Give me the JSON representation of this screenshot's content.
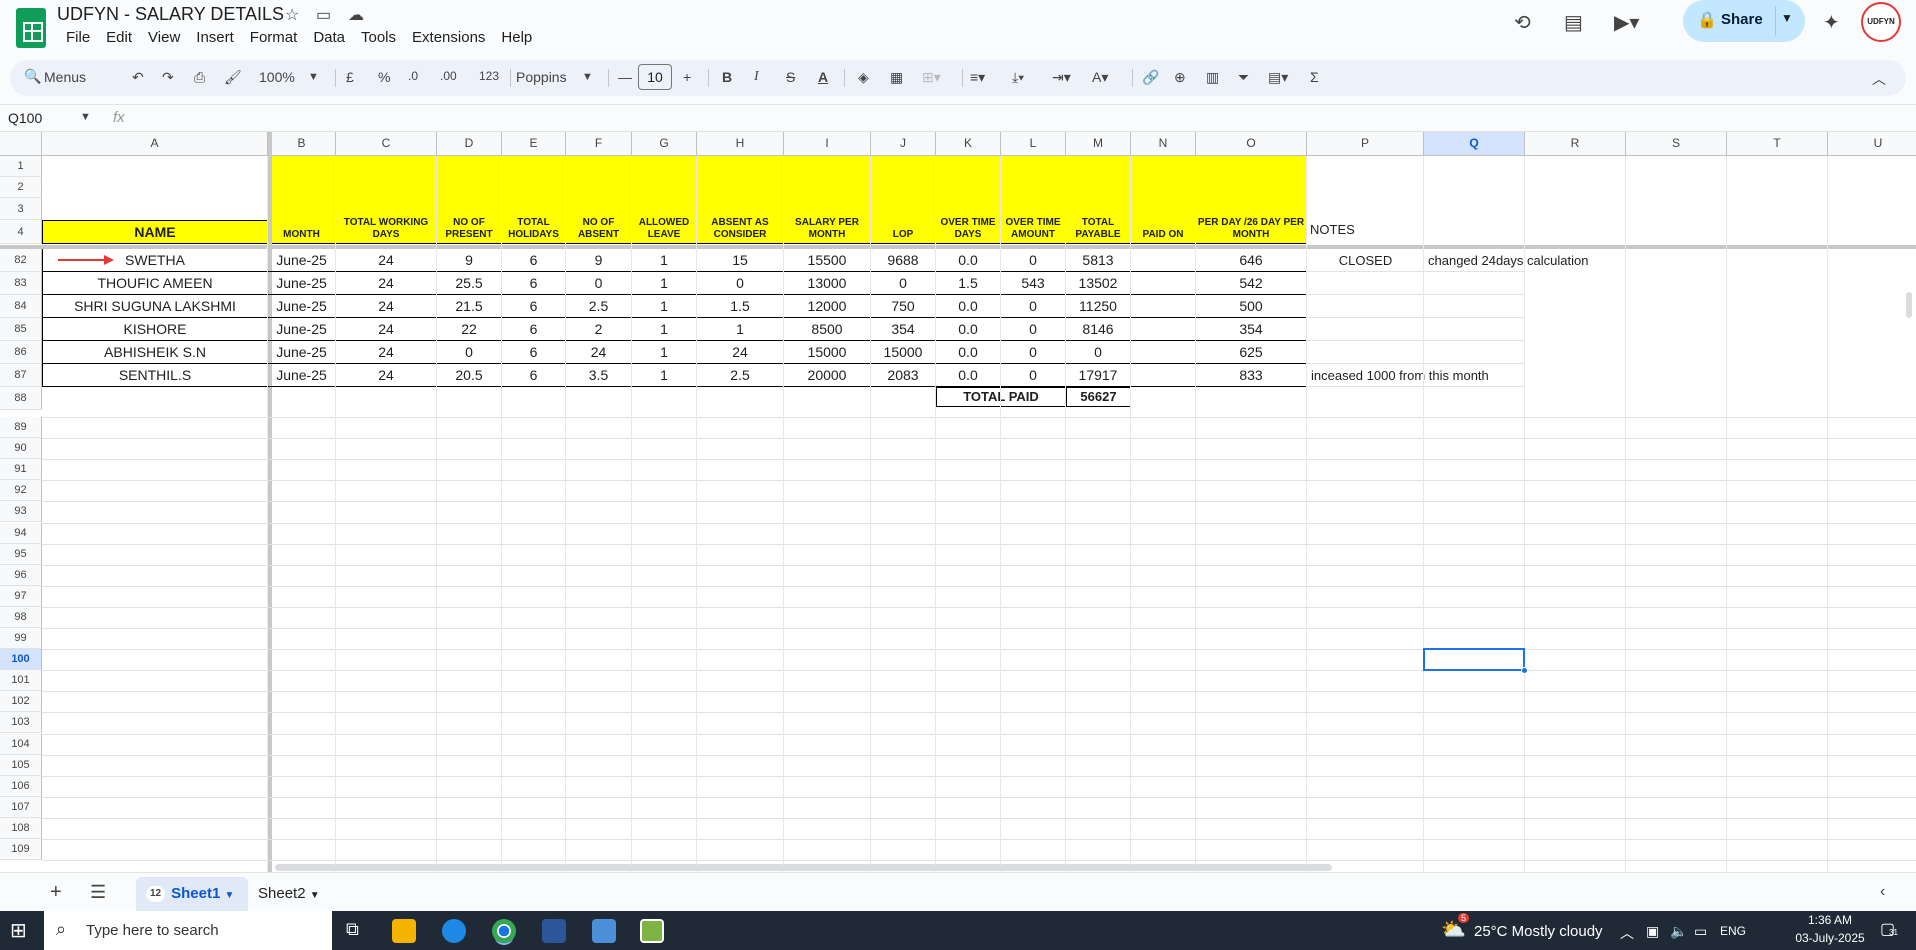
{
  "app": {
    "title": "UDFYN - SALARY DETAILS",
    "menus": [
      "File",
      "Edit",
      "View",
      "Insert",
      "Format",
      "Data",
      "Tools",
      "Extensions",
      "Help"
    ],
    "share_label": "Share",
    "avatar_text": "UDFYN",
    "brand_color": "#0f9d58",
    "accent_color": "#c2e7ff"
  },
  "toolbar": {
    "menus_label": "Menus",
    "zoom": "100%",
    "currency": "£",
    "percent": "%",
    "dec_decrease": ".0",
    "dec_increase": ".00",
    "format_123": "123",
    "font": "Poppins",
    "font_size": "10"
  },
  "formula": {
    "namebox": "Q100",
    "fx": "fx",
    "content": ""
  },
  "columns": [
    "A",
    "B",
    "C",
    "D",
    "E",
    "F",
    "G",
    "H",
    "I",
    "J",
    "K",
    "L",
    "M",
    "N",
    "O",
    "P",
    "Q",
    "R",
    "S",
    "T",
    "U"
  ],
  "selected_column": "Q",
  "frozen_rows": [
    "1",
    "2",
    "3",
    "4"
  ],
  "data_row_numbers": [
    "82",
    "83",
    "84",
    "85",
    "86",
    "87",
    "88"
  ],
  "empty_row_numbers": [
    "89",
    "90",
    "91",
    "92",
    "93",
    "94",
    "95",
    "96",
    "97",
    "98",
    "99",
    "100",
    "101",
    "102",
    "103",
    "104",
    "105",
    "106",
    "107",
    "108",
    "109"
  ],
  "selected_row": "100",
  "headers": {
    "name": "NAME",
    "month": "MONTH",
    "total_working_days": "TOTAL WORKING DAYS",
    "no_of_present": "NO OF PRESENT",
    "total_holidays": "TOTAL HOLIDAYS",
    "no_of_absent": "NO OF ABSENT",
    "allowed_leave": "ALLOWED LEAVE",
    "absent_as_consider": "ABSENT AS CONSIDER",
    "salary_per_month": "SALARY PER MONTH",
    "lop": "LOP",
    "over_time_days": "OVER TIME DAYS",
    "over_time_amount": "OVER TIME AMOUNT",
    "total_payable": "TOTAL PAYABLE",
    "paid_on": "PAID ON",
    "per_day": "PER DAY /26 DAY PER MONTH",
    "notes": "NOTES"
  },
  "rows": [
    {
      "name": "SWETHA",
      "month": "June-25",
      "twd": "24",
      "present": "9",
      "holidays": "6",
      "absent": "9",
      "allowed": "1",
      "consider": "15",
      "salary": "15500",
      "lop": "9688",
      "ot_days": "0.0",
      "ot_amount": "0",
      "payable": "5813",
      "paid_on": "",
      "per_day": "646",
      "note_p": "CLOSED",
      "note_q": "changed 24days calculation"
    },
    {
      "name": "THOUFIC AMEEN",
      "month": "June-25",
      "twd": "24",
      "present": "25.5",
      "holidays": "6",
      "absent": "0",
      "allowed": "1",
      "consider": "0",
      "salary": "13000",
      "lop": "0",
      "ot_days": "1.5",
      "ot_amount": "543",
      "payable": "13502",
      "paid_on": "",
      "per_day": "542",
      "note_p": "",
      "note_q": ""
    },
    {
      "name": "SHRI SUGUNA LAKSHMI",
      "month": "June-25",
      "twd": "24",
      "present": "21.5",
      "holidays": "6",
      "absent": "2.5",
      "allowed": "1",
      "consider": "1.5",
      "salary": "12000",
      "lop": "750",
      "ot_days": "0.0",
      "ot_amount": "0",
      "payable": "11250",
      "paid_on": "",
      "per_day": "500",
      "note_p": "",
      "note_q": ""
    },
    {
      "name": "KISHORE",
      "month": "June-25",
      "twd": "24",
      "present": "22",
      "holidays": "6",
      "absent": "2",
      "allowed": "1",
      "consider": "1",
      "salary": "8500",
      "lop": "354",
      "ot_days": "0.0",
      "ot_amount": "0",
      "payable": "8146",
      "paid_on": "",
      "per_day": "354",
      "note_p": "",
      "note_q": ""
    },
    {
      "name": "ABHISHEIK S.N",
      "month": "June-25",
      "twd": "24",
      "present": "0",
      "holidays": "6",
      "absent": "24",
      "allowed": "1",
      "consider": "24",
      "salary": "15000",
      "lop": "15000",
      "ot_days": "0.0",
      "ot_amount": "0",
      "payable": "0",
      "paid_on": "",
      "per_day": "625",
      "note_p": "",
      "note_q": ""
    },
    {
      "name": "SENTHIL.S",
      "month": "June-25",
      "twd": "24",
      "present": "20.5",
      "holidays": "6",
      "absent": "3.5",
      "allowed": "1",
      "consider": "2.5",
      "salary": "20000",
      "lop": "2083",
      "ot_days": "0.0",
      "ot_amount": "0",
      "payable": "17917",
      "paid_on": "",
      "per_day": "833",
      "note_p": "inceased 1000  from this month",
      "note_q": ""
    }
  ],
  "total": {
    "label": "TOTAL PAID",
    "value": "56627"
  },
  "sheets": [
    {
      "name": "Sheet1",
      "badge": "12",
      "active": true
    },
    {
      "name": "Sheet2",
      "badge": "",
      "active": false
    }
  ],
  "taskbar": {
    "search_placeholder": "Type here to search",
    "weather_badge": "5",
    "weather": "25°C  Mostly cloudy",
    "lang": "ENG",
    "time": "1:36 AM",
    "date": "03-July-2025",
    "notif_count": "31"
  }
}
